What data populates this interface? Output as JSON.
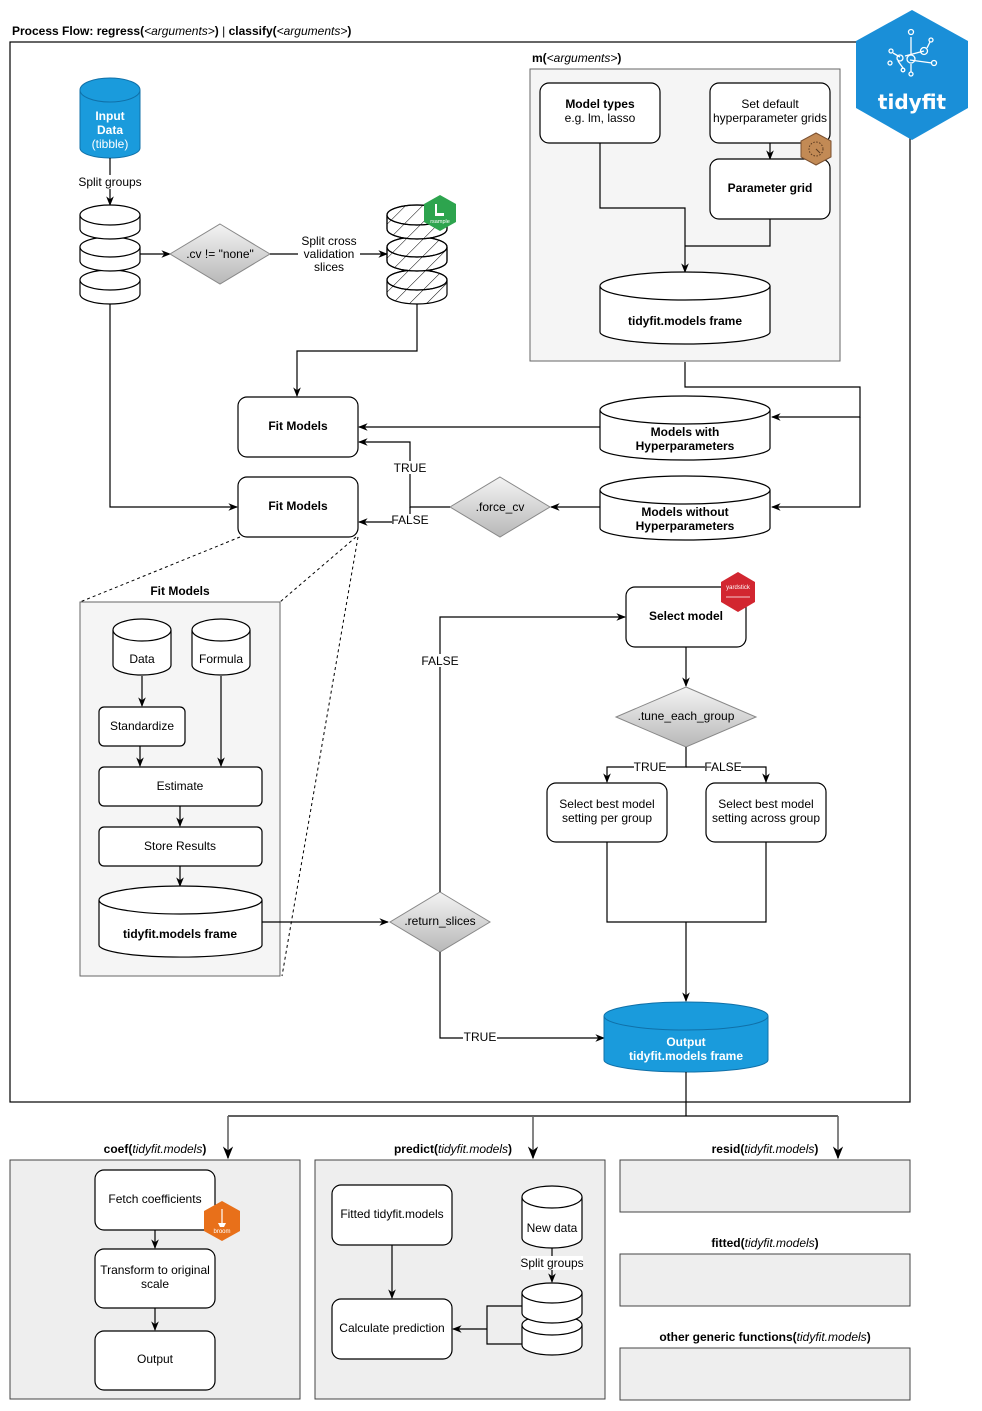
{
  "title": {
    "prefix": "Process Flow: ",
    "fn1": "regress(",
    "arg1": "<arguments>",
    "close1": ")",
    "sep": " | ",
    "fn2": "classify(",
    "arg2": "<arguments>",
    "close2": ")"
  },
  "logo": {
    "text": "tidyfit",
    "color": "#1a8fd8"
  },
  "colors": {
    "accent_blue": "#1a9bdc",
    "rsample_green": "#2da44e",
    "yardstick_red": "#d22630",
    "broom_orange": "#e8701a",
    "dials_brown": "#c28a55",
    "diamond_top": "#f4f4f4",
    "diamond_bottom": "#b8b8b8"
  },
  "m_block": {
    "fn": "m(",
    "arg": "<arguments>",
    "close": ")",
    "model_types_title": "Model types",
    "model_types_sub": "e.g. lm, lasso",
    "set_default_line1": "Set default",
    "set_default_line2": "hyperparameter grids",
    "parameter_grid": "Parameter grid",
    "models_frame": "tidyfit.models frame",
    "dials_badge": "dials"
  },
  "input": {
    "line1": "Input",
    "line2": "Data",
    "line3": "(tibble)",
    "split_groups": "Split groups"
  },
  "cv": {
    "decision": ".cv != \"none\"",
    "edge_line1": "Split cross",
    "edge_line2": "validation",
    "edge_line3": "slices",
    "rsample_badge": "rsample"
  },
  "fit": {
    "fit_models_top": "Fit Models",
    "fit_models_bottom": "Fit Models",
    "models_with_line1": "Models with",
    "models_with_line2": "Hyperparameters",
    "models_without_line1": "Models without",
    "models_without_line2": "Hyperparameters",
    "force_cv": ".force_cv",
    "true_label": "TRUE",
    "false_label": "FALSE"
  },
  "fit_detail": {
    "title": "Fit Models",
    "data": "Data",
    "formula": "Formula",
    "standardize": "Standardize",
    "estimate": "Estimate",
    "store_results": "Store Results",
    "frame": "tidyfit.models frame"
  },
  "selection": {
    "return_slices": ".return_slices",
    "false_label": "FALSE",
    "true_label": "TRUE",
    "select_model": "Select model",
    "yardstick_badge": "yardstick",
    "tune_each_group": ".tune_each_group",
    "tune_true": "TRUE",
    "tune_false": "FALSE",
    "per_group_line1": "Select best model",
    "per_group_line2": "setting per group",
    "across_group_line1": "Select best model",
    "across_group_line2": "setting across group",
    "output_line1": "Output",
    "output_line2": "tidyfit.models frame"
  },
  "generics": {
    "coef": {
      "fn": "coef(",
      "arg": "tidyfit.models",
      "close": ")",
      "fetch": "Fetch coefficients",
      "transform_line1": "Transform to original",
      "transform_line2": "scale",
      "output": "Output",
      "broom_badge": "broom"
    },
    "predict": {
      "fn": "predict(",
      "arg": "tidyfit.models",
      "close": ")",
      "fitted_models": "Fitted tidyfit.models",
      "new_data": "New data",
      "split_groups": "Split groups",
      "calculate": "Calculate prediction"
    },
    "resid": {
      "fn": "resid(",
      "arg": "tidyfit.models",
      "close": ")"
    },
    "fitted": {
      "fn": "fitted(",
      "arg": "tidyfit.models",
      "close": ")"
    },
    "other": {
      "fn": "other generic functions(",
      "arg": "tidyfit.models",
      "close": ")"
    }
  }
}
